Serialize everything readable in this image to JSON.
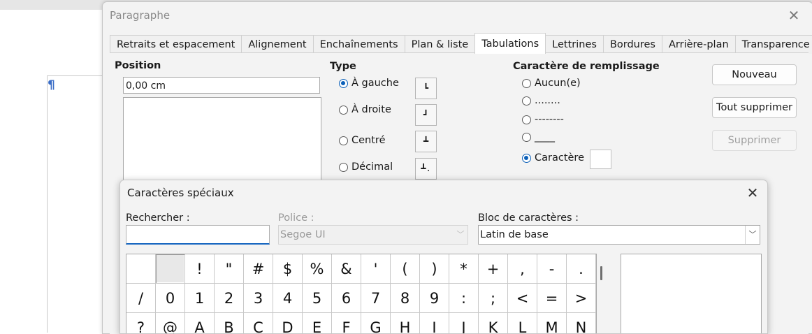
{
  "document": {
    "pilcrow": "¶"
  },
  "paragraph_dialog": {
    "title": "Paragraphe",
    "tabs": [
      {
        "label": "Retraits et espacement"
      },
      {
        "label": "Alignement"
      },
      {
        "label": "Enchaînements"
      },
      {
        "label": "Plan & liste"
      },
      {
        "label": "Tabulations",
        "active": true
      },
      {
        "label": "Lettrines"
      },
      {
        "label": "Bordures"
      },
      {
        "label": "Arrière-plan"
      },
      {
        "label": "Transparence"
      }
    ],
    "position": {
      "label": "Position",
      "value": "0,00 cm"
    },
    "type": {
      "label": "Type",
      "options": [
        {
          "label": "À gauche",
          "selected": true,
          "icon": "left-tab-icon"
        },
        {
          "label": "À droite",
          "selected": false,
          "icon": "right-tab-icon"
        },
        {
          "label": "Centré",
          "selected": false,
          "icon": "center-tab-icon"
        },
        {
          "label": "Décimal",
          "selected": false,
          "icon": "decimal-tab-icon"
        }
      ]
    },
    "fill": {
      "label": "Caractère de remplissage",
      "options": [
        {
          "label": "Aucun(e)",
          "selected": false
        },
        {
          "label": "........",
          "selected": false
        },
        {
          "label": "--------",
          "selected": false
        },
        {
          "label": "____",
          "selected": false
        },
        {
          "label": "Caractère",
          "selected": true
        }
      ],
      "char_value": ""
    },
    "buttons": {
      "new": "Nouveau",
      "delete_all": "Tout supprimer",
      "delete": "Supprimer"
    }
  },
  "special_chars_dialog": {
    "title": "Caractères spéciaux",
    "search": {
      "label": "Rechercher :",
      "value": ""
    },
    "font": {
      "label": "Police :",
      "value": "Segoe UI",
      "enabled": false
    },
    "block": {
      "label": "Bloc de caractères :",
      "value": "Latin de base"
    },
    "grid_rows": [
      [
        " ",
        " ",
        "!",
        "\"",
        "#",
        "$",
        "%",
        "&",
        "'",
        "(",
        ")",
        "*",
        "+",
        ",",
        "-",
        "."
      ],
      [
        "/",
        "0",
        "1",
        "2",
        "3",
        "4",
        "5",
        "6",
        "7",
        "8",
        "9",
        ":",
        ";",
        "<",
        "=",
        ">"
      ],
      [
        "?",
        "@",
        "A",
        "B",
        "C",
        "D",
        "E",
        "F",
        "G",
        "H",
        "I",
        "J",
        "K",
        "L",
        "M",
        "N"
      ]
    ],
    "selected_cell": [
      0,
      1
    ]
  },
  "colors": {
    "accent": "#0a5fb8",
    "focus_underline": "#1565c0"
  }
}
